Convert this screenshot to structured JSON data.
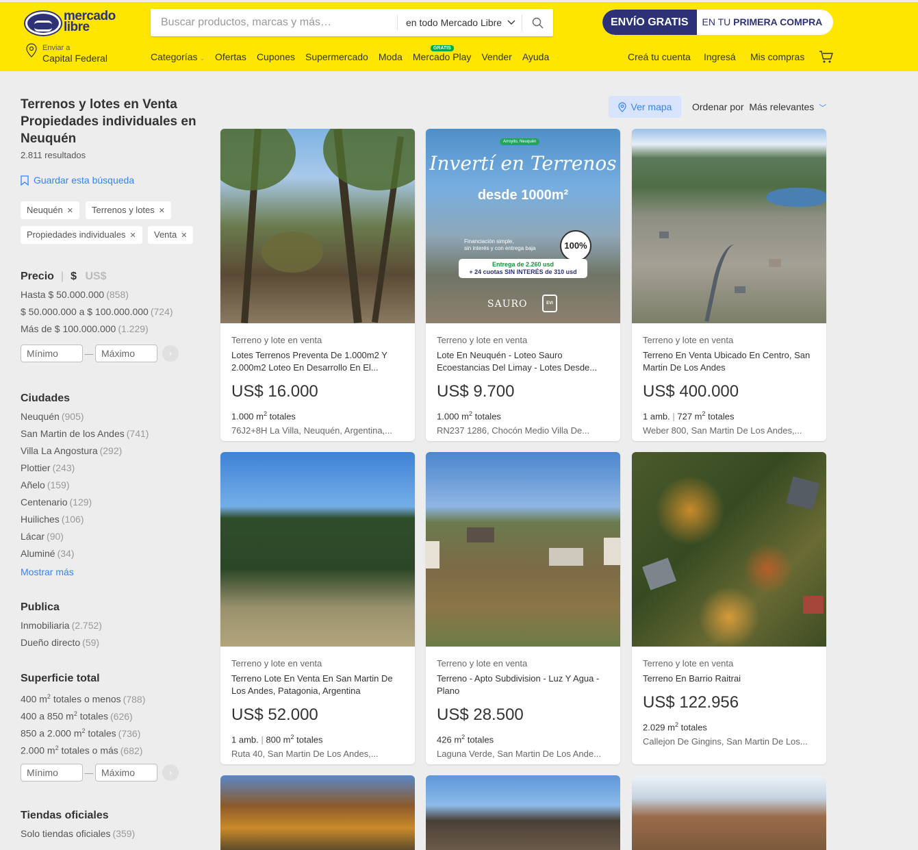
{
  "brand": {
    "line1": "mercado",
    "line2": "libre"
  },
  "search": {
    "placeholder": "Buscar productos, marcas y más…",
    "scope": "en todo Mercado Libre"
  },
  "promo": {
    "part1": "ENVÍO GRATIS",
    "part2_prefix": "EN TU ",
    "part2_bold": "PRIMERA COMPRA"
  },
  "location": {
    "small": "Enviar a",
    "big": "Capital Federal"
  },
  "nav": {
    "categorias": "Categorías",
    "ofertas": "Ofertas",
    "cupones": "Cupones",
    "supermercado": "Supermercado",
    "moda": "Moda",
    "mercado_play": "Mercado Play",
    "gratis_badge": "GRATIS",
    "vender": "Vender",
    "ayuda": "Ayuda"
  },
  "account": {
    "crea": "Creá tu cuenta",
    "ingresa": "Ingresá",
    "compras": "Mis compras"
  },
  "page": {
    "title": "Terrenos y lotes en Venta Propiedades individuales en Neuquén",
    "results": "2.811 resultados",
    "save_search": "Guardar esta búsqueda"
  },
  "chips": [
    "Neuquén",
    "Terrenos y lotes",
    "Propiedades individuales",
    "Venta"
  ],
  "price": {
    "title": "Precio",
    "cur1": "$",
    "cur2": "US$",
    "items": [
      {
        "label": "Hasta $ 50.000.000",
        "count": "(858)"
      },
      {
        "label": "$ 50.000.000 a $ 100.000.000",
        "count": "(724)"
      },
      {
        "label": "Más de $ 100.000.000",
        "count": "(1.229)"
      }
    ],
    "min_placeholder": "Mínimo",
    "max_placeholder": "Máximo"
  },
  "cities": {
    "title": "Ciudades",
    "items": [
      {
        "label": "Neuquén",
        "count": "(905)"
      },
      {
        "label": "San Martin de los Andes",
        "count": "(741)"
      },
      {
        "label": "Villa La Angostura",
        "count": "(292)"
      },
      {
        "label": "Plottier",
        "count": "(243)"
      },
      {
        "label": "Añelo",
        "count": "(159)"
      },
      {
        "label": "Centenario",
        "count": "(129)"
      },
      {
        "label": "Huiliches",
        "count": "(106)"
      },
      {
        "label": "Lácar",
        "count": "(90)"
      },
      {
        "label": "Aluminé",
        "count": "(34)"
      }
    ],
    "show_more": "Mostrar más"
  },
  "publisher": {
    "title": "Publica",
    "items": [
      {
        "label": "Inmobiliaria",
        "count": "(2.752)"
      },
      {
        "label": "Dueño directo",
        "count": "(59)"
      }
    ]
  },
  "surface": {
    "title": "Superficie total",
    "items": [
      {
        "pre": "400 m",
        "post": " totales o menos",
        "count": "(788)"
      },
      {
        "pre": "400 a 850 m",
        "post": " totales",
        "count": "(626)"
      },
      {
        "pre": "850 a 2.000 m",
        "post": " totales",
        "count": "(736)"
      },
      {
        "pre": "2.000 m",
        "post": " totales o más",
        "count": "(682)"
      }
    ],
    "sup": "2",
    "min_placeholder": "Mínimo",
    "max_placeholder": "Máximo"
  },
  "stores": {
    "title": "Tiendas oficiales",
    "items": [
      {
        "label": "Solo tiendas oficiales",
        "count": "(359)"
      }
    ]
  },
  "toolbar": {
    "map": "Ver mapa",
    "sort_label": "Ordenar por",
    "sort_value": "Más relevantes"
  },
  "ad": {
    "loc": "Arroyito, Neuquén",
    "title1": "Invertí en Terrenos",
    "title2": "desde 1000m²",
    "fin1": "Financiación simple,",
    "fin2": "sin interés y con entrega baja",
    "pill1": "Entrega de 2.260 usd",
    "pill2": "+ 24 cuotas SIN INTERÉS de 310 usd",
    "seal": "100%",
    "brand": "SAURO",
    "evi": "EVI"
  },
  "listings": [
    {
      "category": "Terreno y lote en venta",
      "title": "Lotes Terrenos Preventa De 1.000m2 Y 2.000m2 Loteo En Desarrollo En El...",
      "price": "US$ 16.000",
      "amb": "",
      "area": "1.000",
      "location": "76J2+8H La Villa, Neuquén, Argentina,..."
    },
    {
      "category": "Terreno y lote en venta",
      "title": "Lote En Neuquén - Loteo Sauro Ecoestancias Del Limay - Lotes Desde...",
      "price": "US$ 9.700",
      "amb": "",
      "area": "1.000",
      "location": "RN237 1286, Chocón Medio Villa De..."
    },
    {
      "category": "Terreno y lote en venta",
      "title": "Terreno En Venta Ubicado En Centro, San Martin De Los Andes",
      "price": "US$ 400.000",
      "amb": "1 amb.",
      "area": "727",
      "location": "Weber 800, San Martin De Los Andes,..."
    },
    {
      "category": "Terreno y lote en venta",
      "title": "Terreno Lote En Venta En San Martin De Los Andes, Patagonia, Argentina",
      "price": "US$ 52.000",
      "amb": "1 amb.",
      "area": "800",
      "location": "Ruta 40, San Martin De Los Andes,..."
    },
    {
      "category": "Terreno y lote en venta",
      "title": "Terreno - Apto Subdivision - Luz Y Agua - Plano",
      "price": "US$ 28.500",
      "amb": "",
      "area": "426",
      "location": "Laguna Verde, San Martin De Los Ande..."
    },
    {
      "category": "Terreno y lote en venta",
      "title": "Terreno En Barrio Raitrai",
      "price": "US$ 122.956",
      "amb": "",
      "area": "2.029",
      "location": "Callejon De Gingins, San Martin De Los..."
    }
  ],
  "unit": {
    "m": " m",
    "sup": "2",
    "totales": " totales"
  }
}
